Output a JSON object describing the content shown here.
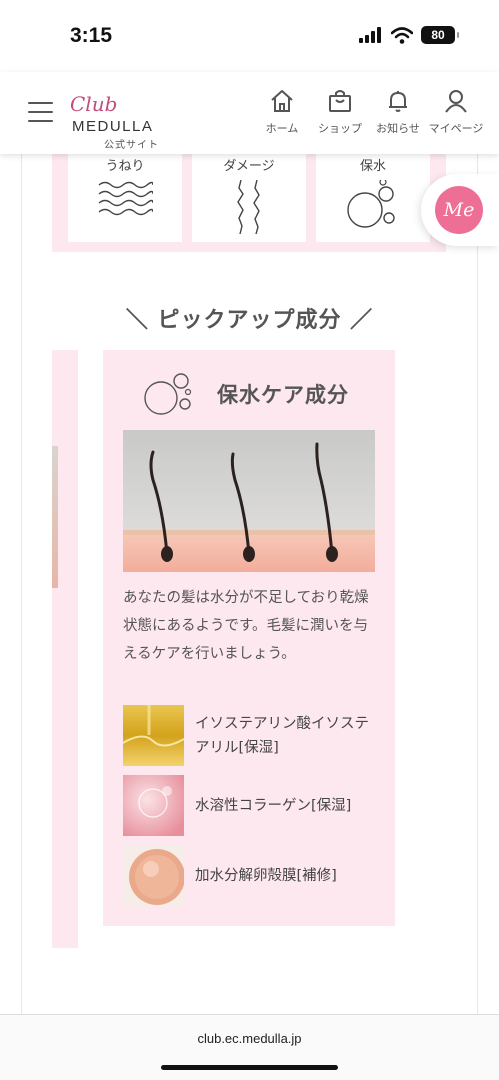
{
  "status_bar": {
    "time": "3:15",
    "battery": "80"
  },
  "header": {
    "logo_club": "Club",
    "logo_brand": "MEDULLA",
    "logo_sub": "公式サイト",
    "nav": [
      {
        "label": "ホーム",
        "icon": "home-icon"
      },
      {
        "label": "ショップ",
        "icon": "shopping-bag-icon"
      },
      {
        "label": "お知らせ",
        "icon": "bell-icon"
      },
      {
        "label": "マイページ",
        "icon": "user-icon"
      }
    ]
  },
  "hair_types": [
    {
      "label": "うねり",
      "icon": "wave-icon"
    },
    {
      "label": "ダメージ",
      "icon": "damage-strands-icon"
    },
    {
      "label": "保水",
      "icon": "bubbles-icon"
    }
  ],
  "me_button": {
    "label": "Me"
  },
  "pickup": {
    "title": "＼ ピックアップ成分 ／",
    "card": {
      "title": "保水ケア成分",
      "icon": "bubbles-icon",
      "description": "あなたの髪は水分が不足しており乾燥状態にあるようです。毛髪に潤いを与えるケアを行いましょう。",
      "ingredients": [
        {
          "name": "イソステアリン酸イソステアリル[保湿]"
        },
        {
          "name": "水溶性コラーゲン[保湿]"
        },
        {
          "name": "加水分解卵殻膜[補修]"
        }
      ]
    }
  },
  "browser": {
    "url": "club.ec.medulla.jp"
  }
}
